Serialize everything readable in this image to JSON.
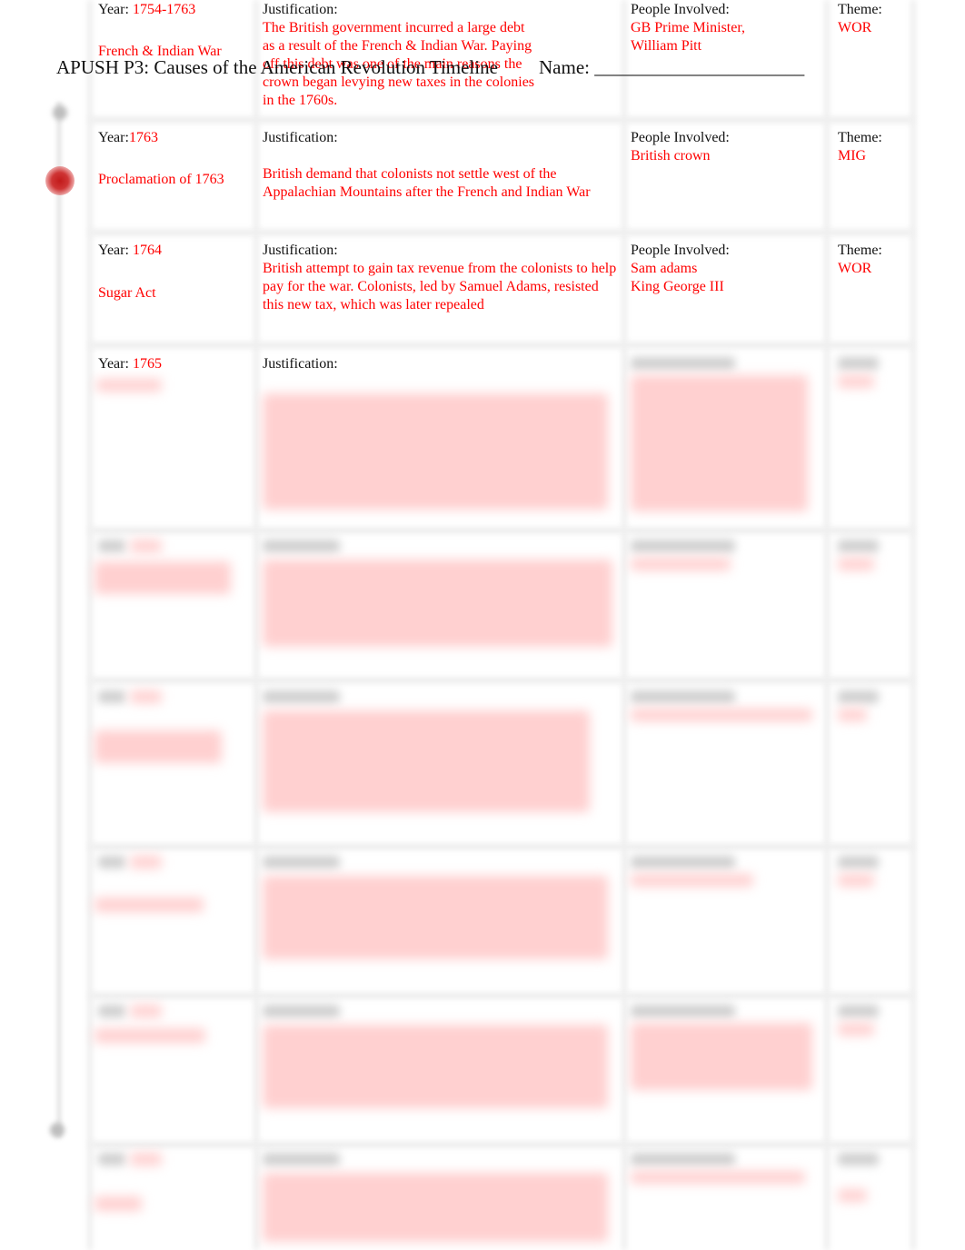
{
  "header": {
    "title": "APUSH P3: Causes of the American Revolution Timeline",
    "name_label": "Name: ______________________"
  },
  "labels": {
    "year": "Year:",
    "justification": "Justification:",
    "people": "People Involved:",
    "theme": "Theme:"
  },
  "entries": [
    {
      "year": "1754-1763",
      "event": "French & Indian War",
      "justification": "The British government incurred a large debt as a result of the French & Indian War. Paying off this debt was one of the main reasons the crown began levying new taxes in the colonies in the 1760s.",
      "people": [
        "GB Prime Minister,",
        "William Pitt"
      ],
      "theme": "WOR"
    },
    {
      "year": "1763",
      "event": "Proclamation of 1763",
      "justification": "British demand that colonists not settle west of the Appalachian Mountains after the French and Indian War",
      "people": [
        "British crown"
      ],
      "theme": "MIG"
    },
    {
      "year": "1764",
      "event": "Sugar Act",
      "justification": "British attempt to gain tax revenue from the colonists to help pay for the war. Colonists, led by Samuel Adams, resisted this new tax, which was later repealed",
      "people": [
        "Sam adams",
        "King George III"
      ],
      "theme": "WOR"
    },
    {
      "year": "1765",
      "event": "",
      "justification": "",
      "people": [],
      "theme": "",
      "obscured": true
    }
  ],
  "obscured_rows": 5,
  "colors": {
    "answer_text": "#ff0000",
    "label_text": "#111111",
    "timeline_dot": "#c21a1a"
  }
}
